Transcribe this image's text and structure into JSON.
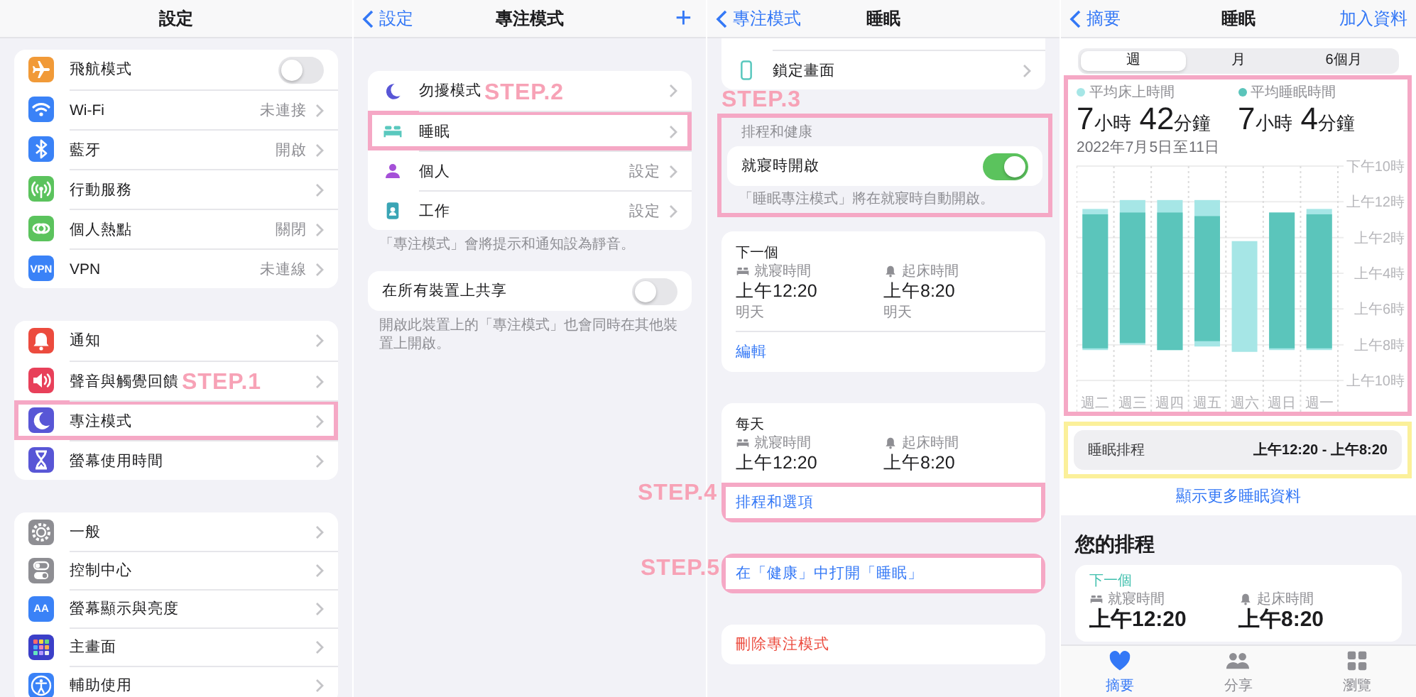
{
  "panels": [
    {
      "kind": "settings",
      "title": "設定",
      "step": "STEP.1",
      "groups": [
        [
          {
            "kind": "toggle",
            "label": "飛航模式",
            "color": "#f19a38",
            "on": false,
            "highlighted": false
          },
          {
            "kind": "link",
            "label": "Wi-Fi",
            "value": "未連接",
            "color": "#3a82f7",
            "highlighted": false
          },
          {
            "kind": "link",
            "label": "藍牙",
            "value": "開啟",
            "color": "#3a82f7",
            "highlighted": false
          },
          {
            "kind": "link",
            "label": "行動服務",
            "color": "#5bc35d",
            "highlighted": false
          },
          {
            "kind": "link",
            "label": "個人熱點",
            "value": "關閉",
            "color": "#5bc35d",
            "highlighted": false
          },
          {
            "kind": "link",
            "label": "VPN",
            "value": "未連線",
            "color": "#3a82f7",
            "icon_text": "VPN",
            "highlighted": false
          }
        ],
        [
          {
            "kind": "link",
            "label": "通知",
            "color": "#ec4b3e",
            "highlighted": false
          },
          {
            "kind": "link",
            "label": "聲音與觸覺回饋",
            "color": "#e8405a",
            "highlighted": false
          },
          {
            "kind": "link",
            "label": "專注模式",
            "color": "#5856d6",
            "highlighted": true
          },
          {
            "kind": "link",
            "label": "螢幕使用時間",
            "color": "#5856d6",
            "highlighted": false
          }
        ],
        [
          {
            "kind": "link",
            "label": "一般",
            "color": "#8e8e93",
            "highlighted": false
          },
          {
            "kind": "link",
            "label": "控制中心",
            "color": "#8e8e93",
            "highlighted": false
          },
          {
            "kind": "link",
            "label": "螢幕顯示與亮度",
            "color": "#3a82f7",
            "icon_text": "AA",
            "highlighted": false
          },
          {
            "kind": "link",
            "label": "主畫面",
            "color": "#3b3fc8",
            "highlighted": false
          },
          {
            "kind": "link",
            "label": "輔助使用",
            "color": "#3a82f7",
            "highlighted": false
          }
        ]
      ]
    },
    {
      "kind": "focus",
      "back": "設定",
      "title": "專注模式",
      "add": "+",
      "step": "STEP.2",
      "modes": [
        {
          "label": "勿擾模式",
          "color": "#5856d6",
          "highlighted": false
        },
        {
          "label": "睡眠",
          "color": "#5ac8be",
          "highlighted": true
        },
        {
          "label": "個人",
          "value": "設定",
          "color": "#a550d8",
          "highlighted": false
        },
        {
          "label": "工作",
          "value": "設定",
          "color": "#3aa5b5",
          "highlighted": false
        }
      ],
      "footer": "「專注模式」會將提示和通知設為靜音。",
      "share": {
        "label": "在所有裝置上共享",
        "on": false
      },
      "share_footer": "開啟此裝置上的「專注模式」也會同時在其他裝置上開啟。"
    },
    {
      "kind": "sleep",
      "back": "專注模式",
      "title": "睡眠",
      "top_row": "鎖定畫面",
      "schedule_section": {
        "color": "#f5a8c5",
        "step": "STEP.3",
        "header": "排程和健康",
        "toggle": {
          "label": "就寢時開啟",
          "on": true
        },
        "footer": "「睡眠專注模式」將在就寢時自動開啟。"
      },
      "next": {
        "title": "下一個",
        "times": [
          {
            "label": "就寢時間",
            "time": "上午12:20",
            "day": "明天"
          },
          {
            "label": "起床時間",
            "time": "上午8:20",
            "day": "明天"
          }
        ],
        "action": "編輯"
      },
      "daily": {
        "title": "每天",
        "times": [
          {
            "label": "就寢時間",
            "time": "上午12:20"
          },
          {
            "label": "起床時間",
            "time": "上午8:20"
          }
        ],
        "action": {
          "label": "排程和選項",
          "highlighted": true,
          "step": "STEP.4"
        }
      },
      "health_link": {
        "label": "在「健康」中打開「睡眠」",
        "highlighted": true,
        "step": "STEP.5"
      },
      "delete": "刪除專注模式"
    },
    {
      "kind": "health",
      "back": "摘要",
      "title": "睡眠",
      "action": "加入資料",
      "segments": [
        {
          "label": "週",
          "selected": true
        },
        {
          "label": "月",
          "selected": false
        },
        {
          "label": "6個月",
          "selected": false
        }
      ],
      "summary": {
        "color": "#f5a8c5",
        "legend": [
          {
            "label": "平均床上時間",
            "color": "#a6e6e6"
          },
          {
            "label": "平均睡眠時間",
            "color": "#5bc5bb"
          }
        ],
        "stats": [
          [
            {
              "number": "7",
              "unit": "小時"
            },
            {
              "number": "42",
              "unit": "分鐘"
            }
          ],
          [
            {
              "number": "7",
              "unit": "小時"
            },
            {
              "number": "4",
              "unit": "分鐘"
            }
          ]
        ],
        "date": "2022年7月5日至11日",
        "chart": {
          "y_labels": [
            "下午10時",
            "上午12時",
            "上午2時",
            "上午4時",
            "上午6時",
            "上午8時",
            "上午10時"
          ],
          "x_labels": [
            "週二",
            "週三",
            "週四",
            "週五",
            "週六",
            "週日",
            "週一"
          ]
        }
      },
      "schedule": {
        "color": "#fbf09a",
        "label": "睡眠排程",
        "value": "上午12:20 - 上午8:20"
      },
      "more_link": "顯示更多睡眠資料",
      "your_schedule": {
        "title": "您的排程",
        "next": "下一個",
        "times": [
          {
            "label": "就寢時間",
            "time": "上午12:20"
          },
          {
            "label": "起床時間",
            "time": "上午8:20"
          }
        ]
      },
      "tabs": [
        {
          "label": "摘要",
          "selected": true
        },
        {
          "label": "分享",
          "selected": false
        },
        {
          "label": "瀏覽",
          "selected": false
        }
      ]
    }
  ]
}
